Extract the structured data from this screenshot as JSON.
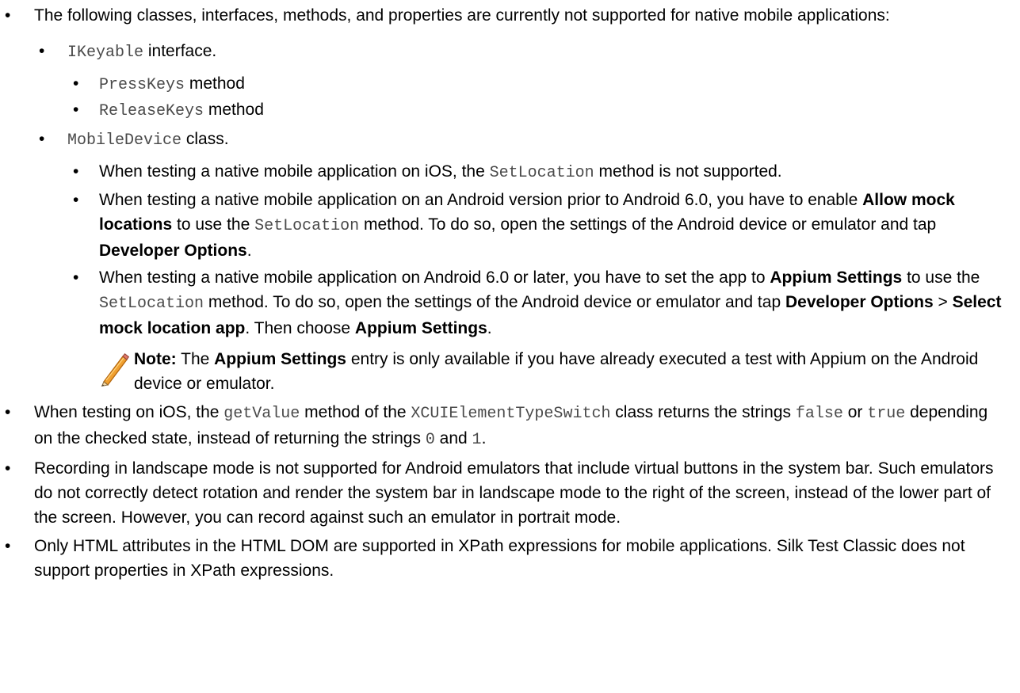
{
  "items": {
    "i1": {
      "text": "The following classes, interfaces, methods, and properties are currently not supported for native mobile applications:",
      "ikeyable": {
        "code": "IKeyable",
        "suffix": " interface.",
        "presskeys": {
          "code": "PressKeys",
          "suffix": " method"
        },
        "releasekeys": {
          "code": "ReleaseKeys",
          "suffix": " method"
        }
      },
      "mobiledevice": {
        "code": "MobileDevice",
        "suffix": " class.",
        "ios": {
          "pre": "When testing a native mobile application on iOS, the ",
          "code": "SetLocation",
          "post": " method is not supported."
        },
        "android_pre6": {
          "t1": "When testing a native mobile application on an Android version prior to Android 6.0, you have to enable ",
          "b1": "Allow mock locations",
          "t2": " to use the ",
          "code": "SetLocation",
          "t3": " method. To do so, open the settings of the Android device or emulator and tap ",
          "b2": "Developer Options",
          "t4": "."
        },
        "android_6": {
          "t1": "When testing a native mobile application on Android 6.0 or later, you have to set the app to ",
          "b1": "Appium Settings",
          "t2": " to use the ",
          "code": "SetLocation",
          "t3": " method. To do so, open the settings of the Android device or emulator and tap ",
          "b2": "Developer Options",
          "t4": " > ",
          "b3": "Select mock location app",
          "t5": ". Then choose ",
          "b4": "Appium Settings",
          "t6": ".",
          "note": {
            "label": "Note:",
            "t1": " The ",
            "b1": "Appium Settings",
            "t2": " entry is only available if you have already executed a test with Appium on the Android device or emulator."
          }
        }
      }
    },
    "i2": {
      "t1": "When testing on iOS, the ",
      "c1": "getValue",
      "t2": " method of the ",
      "c2": "XCUIElementTypeSwitch",
      "t3": " class returns the strings ",
      "c3": "false",
      "t4": " or ",
      "c4": "true",
      "t5": " depending on the checked state, instead of returning the strings ",
      "c5": "0",
      "t6": " and ",
      "c6": "1",
      "t7": "."
    },
    "i3": {
      "text": "Recording in landscape mode is not supported for Android emulators that include virtual buttons in the system bar. Such emulators do not correctly detect rotation and render the system bar in landscape mode to the right of the screen, instead of the lower part of the screen. However, you can record against such an emulator in portrait mode."
    },
    "i4": {
      "text": "Only HTML attributes in the HTML DOM are supported in XPath expressions for mobile applications. Silk Test Classic does not support properties in XPath expressions."
    }
  },
  "bullet_char": "•",
  "icons": {
    "note": "pencil-icon"
  },
  "colors": {
    "text": "#000000",
    "code": "#4a4a4a",
    "pencil": "#f0a030"
  }
}
